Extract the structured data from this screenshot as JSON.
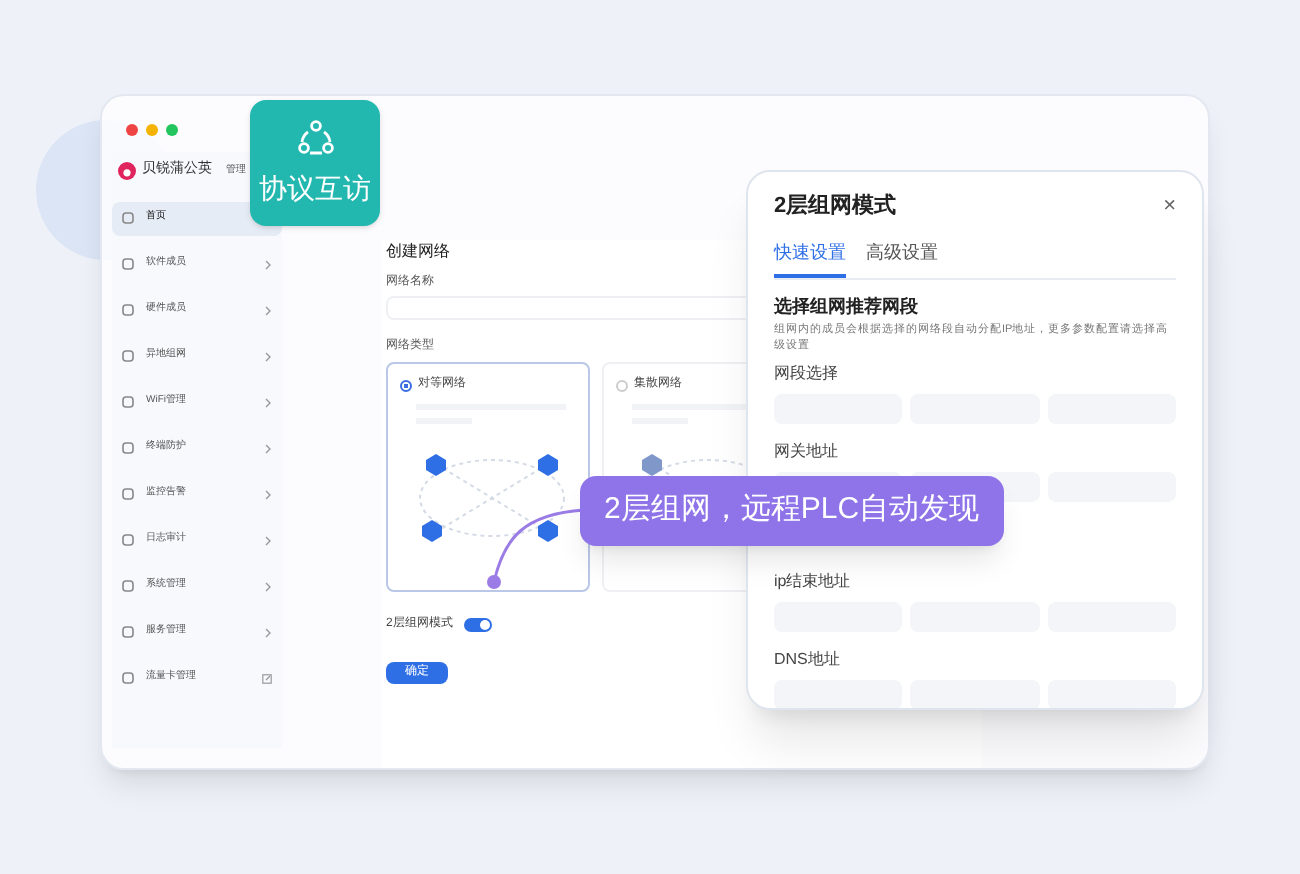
{
  "badge": {
    "label": "协议互访"
  },
  "brand": {
    "name": "贝锐蒲公英",
    "suffix": "管理"
  },
  "sidebar": {
    "items": [
      {
        "label": "首页",
        "selected": true,
        "kind": "plain"
      },
      {
        "label": "软件成员",
        "selected": false,
        "kind": "menu"
      },
      {
        "label": "硬件成员",
        "selected": false,
        "kind": "menu"
      },
      {
        "label": "异地组网",
        "selected": false,
        "kind": "menu"
      },
      {
        "label": "WiFi管理",
        "selected": false,
        "kind": "menu"
      },
      {
        "label": "终端防护",
        "selected": false,
        "kind": "menu"
      },
      {
        "label": "监控告警",
        "selected": false,
        "kind": "menu"
      },
      {
        "label": "日志审计",
        "selected": false,
        "kind": "menu"
      },
      {
        "label": "系统管理",
        "selected": false,
        "kind": "menu"
      },
      {
        "label": "服务管理",
        "selected": false,
        "kind": "menu"
      },
      {
        "label": "流量卡管理",
        "selected": false,
        "kind": "link"
      }
    ]
  },
  "form": {
    "title": "创建网络",
    "name_label": "网络名称",
    "type_label": "网络类型",
    "types": [
      {
        "label": "对等网络",
        "selected": true
      },
      {
        "label": "集散网络",
        "selected": false
      }
    ],
    "toggle": {
      "label": "2层组网模式",
      "on": true
    },
    "submit": "确定"
  },
  "callout": {
    "text": "2层组网，远程PLC自动发现"
  },
  "dialog": {
    "title": "2层组网模式",
    "close": "×",
    "tabs": [
      {
        "label": "快速设置",
        "selected": true
      },
      {
        "label": "高级设置",
        "selected": false
      }
    ],
    "heading": "选择组网推荐网段",
    "description": "组网内的成员会根据选择的网络段自动分配IP地址，更多参数配置请选择高级设置",
    "fields": [
      {
        "label": "网段选择"
      },
      {
        "label": "网关地址"
      },
      {
        "label": "ip结束地址"
      },
      {
        "label": "DNS地址"
      }
    ]
  }
}
